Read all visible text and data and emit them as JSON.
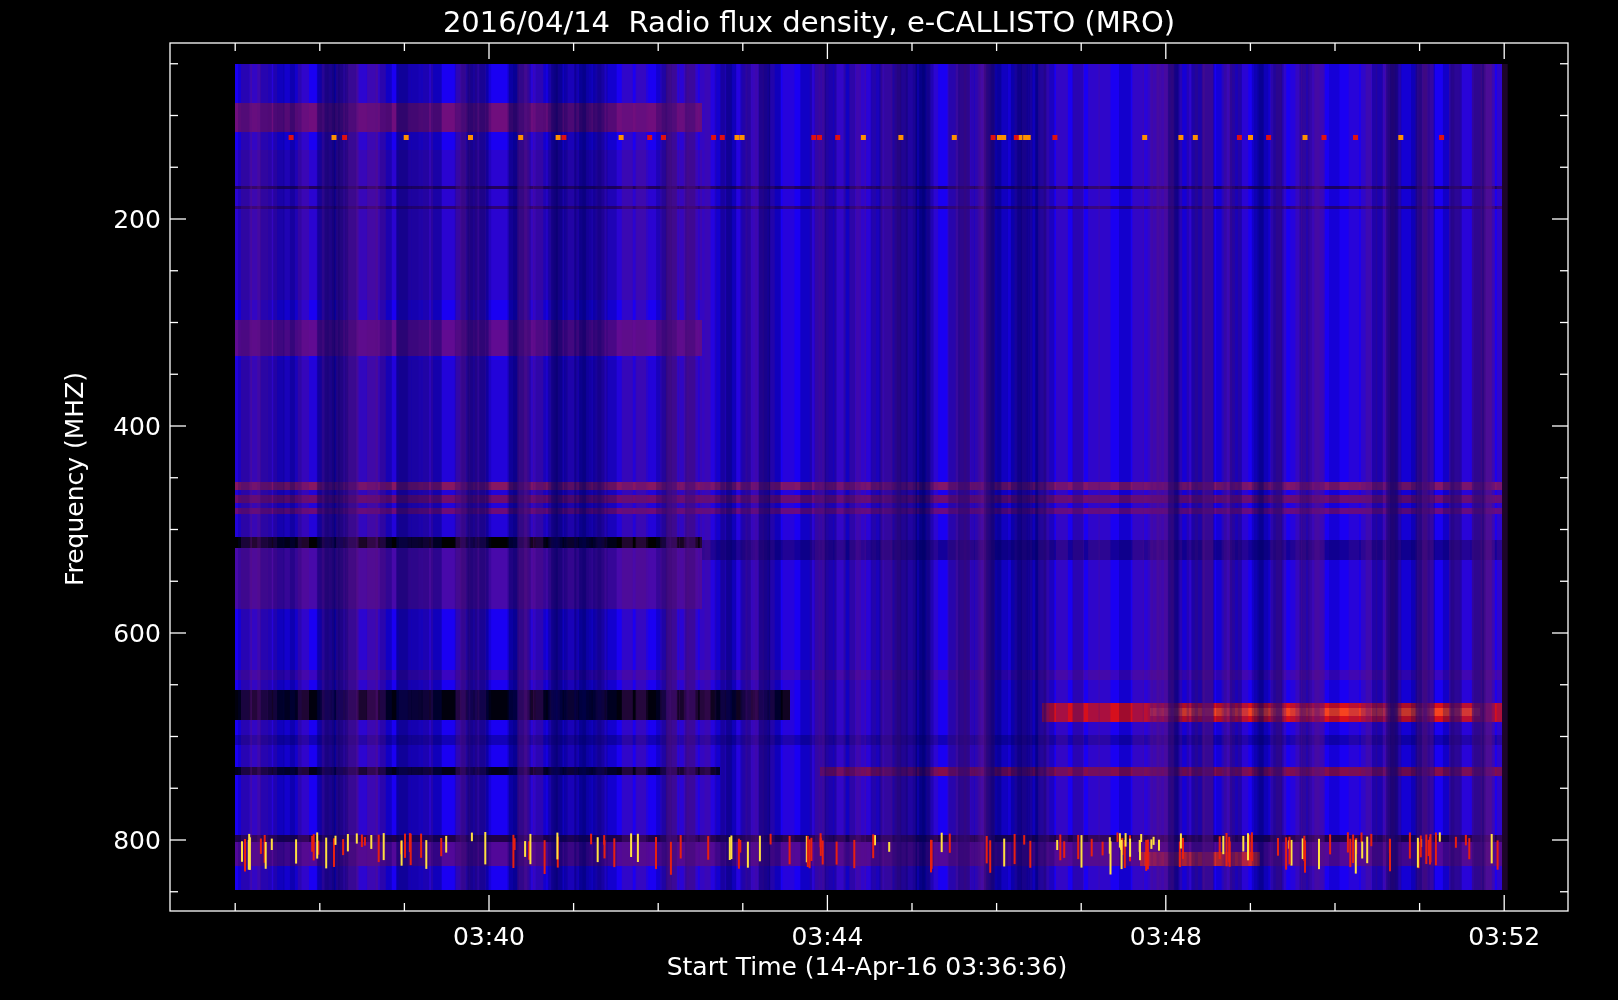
{
  "title": "2016/04/14  Radio flux density, e-CALLISTO (MRO)",
  "y_axis": {
    "label": "Frequency (MHZ)",
    "ticks": [
      "200",
      "400",
      "600",
      "800"
    ]
  },
  "x_axis": {
    "label": "Start Time (14-Apr-16 03:36:36)",
    "ticks": [
      "03:40",
      "03:44",
      "03:48",
      "03:52"
    ]
  }
}
